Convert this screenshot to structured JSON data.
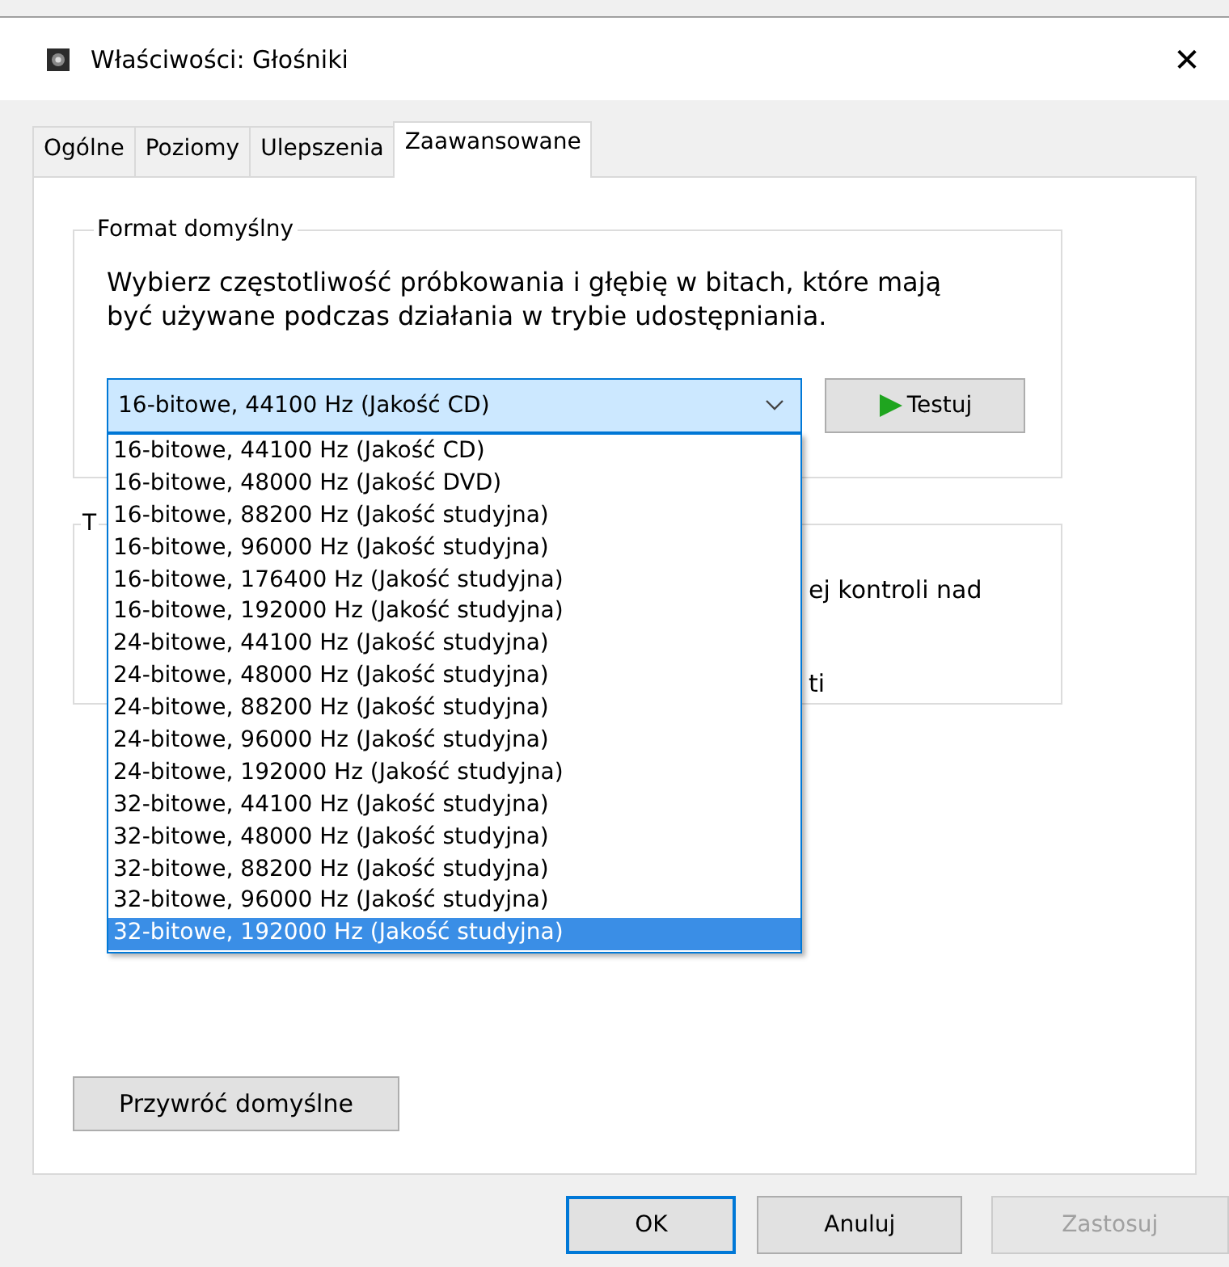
{
  "window": {
    "title": "Właściwości: Głośniki",
    "close": "✕"
  },
  "tabs": [
    {
      "label": "Ogólne",
      "selected": false
    },
    {
      "label": "Poziomy",
      "selected": false
    },
    {
      "label": "Ulepszenia",
      "selected": false
    },
    {
      "label": "Zaawansowane",
      "selected": true
    }
  ],
  "default_format": {
    "title": "Format domyślny",
    "description": "Wybierz częstotliwość próbkowania i głębię w bitach, które mają być używane podczas działania w trybie udostępniania.",
    "combo": {
      "value": "16-bitowe, 44100 Hz (Jakość CD)",
      "expanded": true
    },
    "test_button": "Testuj",
    "options": [
      {
        "label": "16-bitowe, 44100 Hz (Jakość CD)",
        "selected": false
      },
      {
        "label": "16-bitowe, 48000 Hz (Jakość DVD)",
        "selected": false
      },
      {
        "label": "16-bitowe, 88200 Hz (Jakość studyjna)",
        "selected": false
      },
      {
        "label": "16-bitowe, 96000 Hz (Jakość studyjna)",
        "selected": false
      },
      {
        "label": "16-bitowe, 176400 Hz (Jakość studyjna)",
        "selected": false
      },
      {
        "label": "16-bitowe, 192000 Hz (Jakość studyjna)",
        "selected": false
      },
      {
        "label": "24-bitowe, 44100 Hz (Jakość studyjna)",
        "selected": false
      },
      {
        "label": "24-bitowe, 48000 Hz (Jakość studyjna)",
        "selected": false
      },
      {
        "label": "24-bitowe, 88200 Hz (Jakość studyjna)",
        "selected": false
      },
      {
        "label": "24-bitowe, 96000 Hz (Jakość studyjna)",
        "selected": false
      },
      {
        "label": "24-bitowe, 192000 Hz (Jakość studyjna)",
        "selected": false
      },
      {
        "label": "32-bitowe, 44100 Hz (Jakość studyjna)",
        "selected": false
      },
      {
        "label": "32-bitowe, 48000 Hz (Jakość studyjna)",
        "selected": false
      },
      {
        "label": "32-bitowe, 88200 Hz (Jakość studyjna)",
        "selected": false
      },
      {
        "label": "32-bitowe, 96000 Hz (Jakość studyjna)",
        "selected": false
      },
      {
        "label": "32-bitowe, 192000 Hz (Jakość studyjna)",
        "selected": true
      }
    ]
  },
  "second_group": {
    "title": "T",
    "line_1": "ej kontroli nad",
    "line_2": "ti"
  },
  "restore_button": "Przywróć domyślne",
  "buttons": [
    {
      "label": "OK",
      "kind": "default"
    },
    {
      "label": "Anuluj",
      "kind": "normal"
    },
    {
      "label": "Zastosuj",
      "kind": "disabled"
    }
  ]
}
